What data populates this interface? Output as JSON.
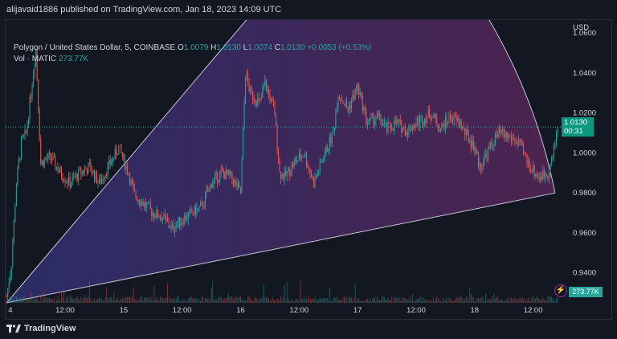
{
  "header": {
    "attribution": "alijavaid1886 published on TradingView.com, Jan 18, 2023 14:09 UTC"
  },
  "legend": {
    "symbol": "Polygon / United States Dollar, 5, COINBASE",
    "open_label": "O",
    "open": "1.0079",
    "high_label": "H",
    "high": "1.0130",
    "low_label": "L",
    "low": "1.0074",
    "close_label": "C",
    "close": "1.0130",
    "change": "+0.0053 (+0.53%)",
    "vol_label": "Vol · MATIC",
    "vol": "273.77K"
  },
  "price_axis": {
    "currency": "USD",
    "last_price": "1.0130",
    "countdown": "00:31",
    "vol_value": "273.77K"
  },
  "footer": {
    "brand": "TradingView"
  },
  "colors": {
    "background": "#131722",
    "up": "#26a69a",
    "down": "#ef5350",
    "fan_fill_start": "#3d3f9e",
    "fan_fill_end": "#7b2d74",
    "fan_line": "#c9c3d6"
  },
  "chart_data": {
    "type": "candlestick",
    "title": "Polygon / United States Dollar, 5, COINBASE",
    "ylabel": "USD",
    "ylim": [
      0.925,
      1.0665
    ],
    "y_ticks": [
      "0.9400",
      "0.9600",
      "0.9800",
      "1.0000",
      "1.0200",
      "1.0400",
      "1.0600"
    ],
    "y_tick_values": [
      0.94,
      0.96,
      0.98,
      1.0,
      1.02,
      1.04,
      1.06
    ],
    "x_ticks": [
      "4",
      "12:00",
      "15",
      "12:00",
      "16",
      "12:00",
      "17",
      "12:00",
      "18",
      "12:00"
    ],
    "x_tick_hours": [
      0,
      12,
      24,
      36,
      48,
      60,
      72,
      84,
      96,
      108
    ],
    "xlim_hours": [
      -0.2,
      113.5
    ],
    "last_close": 1.013,
    "price_path": [
      [
        0,
        0.928
      ],
      [
        1,
        0.945
      ],
      [
        2,
        0.985
      ],
      [
        3,
        1.005
      ],
      [
        4,
        1.01
      ],
      [
        5,
        1.03
      ],
      [
        6,
        1.052
      ],
      [
        7,
        0.995
      ],
      [
        9,
        0.998
      ],
      [
        11,
        0.99
      ],
      [
        13,
        0.985
      ],
      [
        15,
        0.99
      ],
      [
        17,
        0.993
      ],
      [
        19,
        0.985
      ],
      [
        22,
        0.998
      ],
      [
        23,
        1.003
      ],
      [
        25,
        0.99
      ],
      [
        26,
        0.98
      ],
      [
        28,
        0.975
      ],
      [
        30,
        0.97
      ],
      [
        32,
        0.968
      ],
      [
        34,
        0.962
      ],
      [
        35,
        0.965
      ],
      [
        38,
        0.97
      ],
      [
        40,
        0.973
      ],
      [
        42,
        0.985
      ],
      [
        44,
        0.99
      ],
      [
        46,
        0.988
      ],
      [
        48,
        0.98
      ],
      [
        49,
        1.04
      ],
      [
        50,
        1.03
      ],
      [
        52,
        1.025
      ],
      [
        53,
        1.035
      ],
      [
        55,
        1.02
      ],
      [
        56,
        0.99
      ],
      [
        57,
        0.988
      ],
      [
        59,
        0.995
      ],
      [
        61,
        1.0
      ],
      [
        63,
        0.985
      ],
      [
        65,
        0.998
      ],
      [
        67,
        1.01
      ],
      [
        68,
        1.03
      ],
      [
        70,
        1.022
      ],
      [
        72,
        1.033
      ],
      [
        74,
        1.015
      ],
      [
        76,
        1.018
      ],
      [
        78,
        1.012
      ],
      [
        80,
        1.015
      ],
      [
        82,
        1.011
      ],
      [
        84,
        1.015
      ],
      [
        86,
        1.018
      ],
      [
        87,
        1.02
      ],
      [
        89,
        1.012
      ],
      [
        91,
        1.018
      ],
      [
        93,
        1.015
      ],
      [
        94,
        1.01
      ],
      [
        96,
        1.003
      ],
      [
        97,
        0.993
      ],
      [
        99,
        1.002
      ],
      [
        101,
        1.01
      ],
      [
        103,
        1.008
      ],
      [
        105,
        1.005
      ],
      [
        107,
        0.995
      ],
      [
        109,
        0.988
      ],
      [
        111,
        0.99
      ],
      [
        112,
        0.998
      ],
      [
        113,
        1.013
      ]
    ],
    "volume_max": "273.77K",
    "annotations": [
      {
        "type": "fan",
        "apex": [
          0,
          0.925
        ],
        "upper_edge_end": [
          49,
          1.066
        ],
        "lower_edge_end": [
          112.5,
          0.98
        ],
        "arc": true
      }
    ]
  }
}
